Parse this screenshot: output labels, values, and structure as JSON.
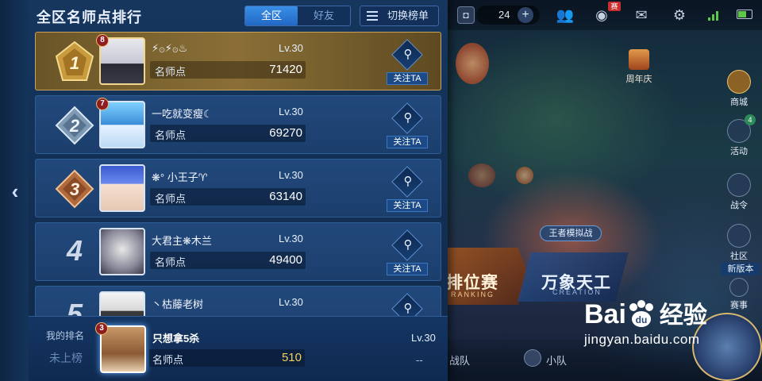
{
  "panel": {
    "title": "全区名师点排行",
    "tabs": [
      {
        "label": "全区",
        "active": true
      },
      {
        "label": "好友",
        "active": false
      }
    ],
    "switch_label": "切换榜单",
    "points_label": "名师点",
    "follow_label": "关注TA",
    "rows": [
      {
        "rank": "1",
        "badge": "8",
        "nickname": "⚡۞⚡۞♨",
        "level": "Lv.30",
        "points": "71420"
      },
      {
        "rank": "2",
        "badge": "7",
        "nickname": "一吃就变瘦☾",
        "level": "Lv.30",
        "points": "69270"
      },
      {
        "rank": "3",
        "badge": "",
        "nickname": "❋° 小王子♈",
        "level": "Lv.30",
        "points": "63140"
      },
      {
        "rank": "4",
        "badge": "",
        "nickname": "大君主❋木兰",
        "level": "Lv.30",
        "points": "49400"
      },
      {
        "rank": "5",
        "badge": "",
        "nickname": "丶枯藤老树",
        "level": "Lv.30",
        "points": ""
      }
    ]
  },
  "my_rank": {
    "title": "我的排名",
    "status": "未上榜",
    "badge": "3",
    "nickname": "只想拿5杀",
    "level": "Lv.30",
    "points_label": "名师点",
    "points": "510",
    "dash": "--"
  },
  "hud": {
    "count": "24",
    "badge": "赛"
  },
  "lobby": {
    "anniversary": "周年庆",
    "side_buttons": [
      "商城",
      "活动",
      "战令",
      "社区",
      "赛事"
    ],
    "activity_badge": "4",
    "new_version": "新版本",
    "simulator_label": "王者模拟战",
    "mode_rank": "排位赛",
    "mode_rank_sub": "RANKING",
    "mode_wanxiang": "万象天工",
    "mode_wanxiang_sub": "CREATION",
    "bottom_items": [
      "战队",
      "小队"
    ]
  },
  "watermark": {
    "brand": "Bai",
    "brand_suffix": "du",
    "jy": "经验",
    "url": "jingyan.baidu.com"
  },
  "colors": {
    "gold_row": "#8a6f36",
    "row": "#1b3e6c",
    "active_tab": "#2268c4",
    "my_points": "#f0d060"
  }
}
